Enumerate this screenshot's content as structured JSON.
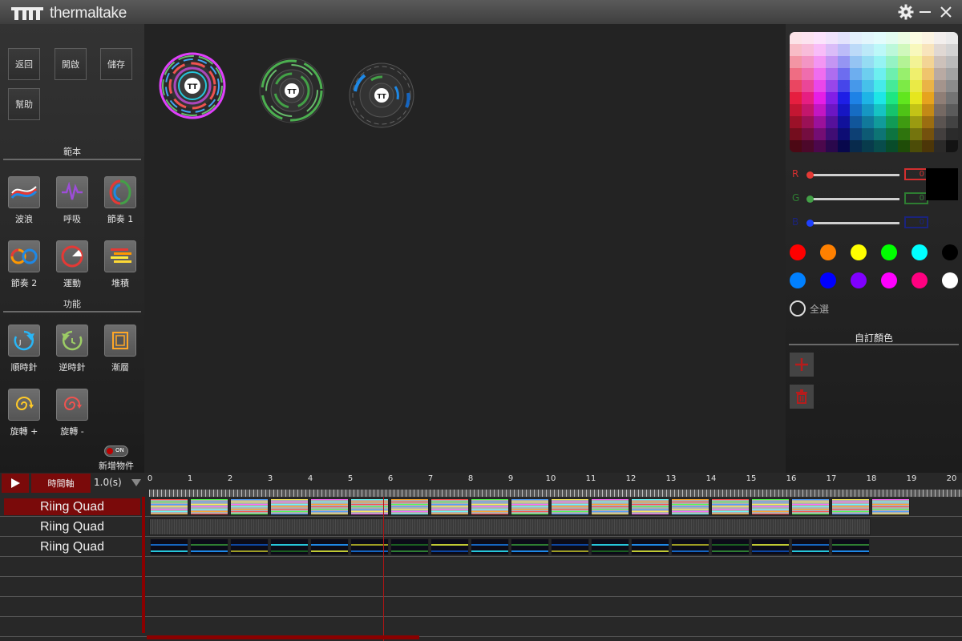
{
  "app": {
    "brand": "thermaltake",
    "settings_icon": "gear-icon",
    "minimize_icon": "minimize-icon",
    "close_icon": "close-icon"
  },
  "toolbar": {
    "back": "返回",
    "open": "開啟",
    "save": "儲存",
    "help": "幫助"
  },
  "templates": {
    "title": "範本",
    "items": [
      {
        "label": "波浪",
        "icon": "wave-icon"
      },
      {
        "label": "呼吸",
        "icon": "breath-icon"
      },
      {
        "label": "節奏 1",
        "icon": "rhythm1-icon"
      },
      {
        "label": "節奏 2",
        "icon": "rhythm2-icon"
      },
      {
        "label": "運動",
        "icon": "motion-icon"
      },
      {
        "label": "堆積",
        "icon": "stack-icon"
      }
    ]
  },
  "functions": {
    "title": "功能",
    "items": [
      {
        "label": "順時針",
        "icon": "clockwise-icon"
      },
      {
        "label": "逆時針",
        "icon": "counterclockwise-icon"
      },
      {
        "label": "漸層",
        "icon": "gradient-icon"
      },
      {
        "label": "旋轉 +",
        "icon": "spin-plus-icon"
      },
      {
        "label": "旋轉 -",
        "icon": "spin-minus-icon"
      }
    ]
  },
  "add_object": {
    "label": "新增物件",
    "toggle": "ON"
  },
  "colors": {
    "r_label": "R",
    "g_label": "G",
    "b_label": "B",
    "r": "0",
    "g": "0",
    "b": "0",
    "current": "#000000",
    "swatches_row1": [
      "#ff0000",
      "#ff8000",
      "#ffff00",
      "#00ff00",
      "#00ffff",
      "#000000"
    ],
    "swatches_row2": [
      "#0080ff",
      "#0000ff",
      "#8000ff",
      "#ff00ff",
      "#ff0080",
      "#ffffff"
    ],
    "select_all": "全選",
    "custom_title": "自訂顏色",
    "add_icon": "plus-icon",
    "delete_icon": "trash-icon"
  },
  "timeline": {
    "play_icon": "play-icon",
    "timeline_button": "時間軸",
    "speed": "1.0(s)",
    "ticks": [
      "0",
      "1",
      "2",
      "3",
      "4",
      "5",
      "6",
      "7",
      "8",
      "9",
      "10",
      "11",
      "12",
      "13",
      "14",
      "15",
      "16",
      "17",
      "18",
      "19",
      "20"
    ],
    "tracks": [
      {
        "name": "Riing Quad",
        "selected": true
      },
      {
        "name": "Riing Quad",
        "selected": false
      },
      {
        "name": "Riing Quad",
        "selected": false
      }
    ]
  }
}
